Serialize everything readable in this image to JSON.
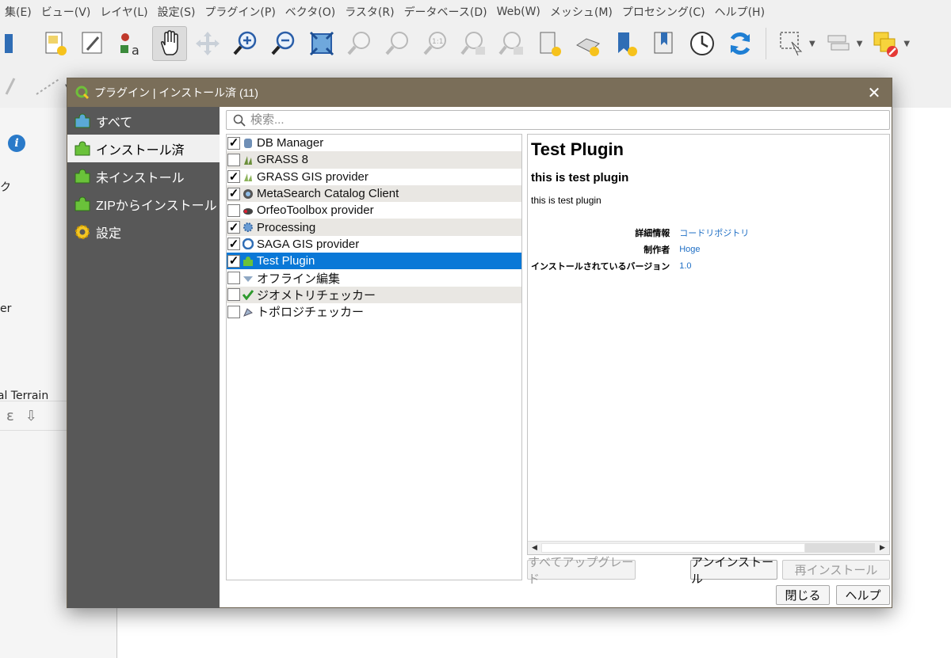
{
  "menubar": {
    "items": [
      "集(E)",
      "ビュー(V)",
      "レイヤ(L)",
      "設定(S)",
      "プラグイン(P)",
      "ベクタ(O)",
      "ラスタ(R)",
      "データベース(D)",
      "Web(W)",
      "メッシュ(M)",
      "プロセシング(C)",
      "ヘルプ(H)"
    ]
  },
  "background": {
    "panel_texts": [
      "ク",
      "er",
      "bal Terrain"
    ],
    "bottom_symbols": [
      "ε",
      "⇩"
    ]
  },
  "dialog": {
    "title": "プラグイン | インストール済 (11)",
    "close_glyph": "✕",
    "sidebar": [
      {
        "label": "すべて",
        "icon": "puzzle-all-icon"
      },
      {
        "label": "インストール済",
        "icon": "puzzle-installed-icon",
        "selected": true
      },
      {
        "label": "未インストール",
        "icon": "puzzle-not-installed-icon"
      },
      {
        "label": "ZIPからインストール",
        "icon": "puzzle-zip-icon"
      },
      {
        "label": "設定",
        "icon": "settings-gear-icon"
      }
    ],
    "search": {
      "placeholder": "検索..."
    },
    "plugins": [
      {
        "name": "DB Manager",
        "checked": true,
        "icon": "db-manager-icon"
      },
      {
        "name": "GRASS 8",
        "checked": false,
        "icon": "grass-icon"
      },
      {
        "name": "GRASS GIS provider",
        "checked": true,
        "icon": "grass-provider-icon"
      },
      {
        "name": "MetaSearch Catalog Client",
        "checked": true,
        "icon": "metasearch-icon"
      },
      {
        "name": "OrfeoToolbox provider",
        "checked": false,
        "icon": "orfeo-icon"
      },
      {
        "name": "Processing",
        "checked": true,
        "icon": "processing-gear-icon"
      },
      {
        "name": "SAGA GIS provider",
        "checked": true,
        "icon": "saga-icon"
      },
      {
        "name": "Test Plugin",
        "checked": true,
        "icon": "plugin-puzzle-icon",
        "selected": true
      },
      {
        "name": "オフライン編集",
        "checked": false,
        "icon": "offline-edit-icon"
      },
      {
        "name": "ジオメトリチェッカー",
        "checked": false,
        "icon": "geometry-checker-icon"
      },
      {
        "name": "トポロジチェッカー",
        "checked": false,
        "icon": "topology-checker-icon"
      }
    ],
    "detail": {
      "title": "Test Plugin",
      "subtitle": "this is test plugin",
      "description": "this is test plugin",
      "fields": [
        {
          "label": "詳細情報",
          "value": "コードリポジトリ"
        },
        {
          "label": "制作者",
          "value": "Hoge"
        },
        {
          "label": "インストールされているバージョン",
          "value": "1.0"
        }
      ]
    },
    "buttons": {
      "upgrade_all": "すべてアップグレード",
      "uninstall": "アンインストール",
      "reinstall": "再インストール",
      "close": "閉じる",
      "help": "ヘルプ"
    }
  }
}
